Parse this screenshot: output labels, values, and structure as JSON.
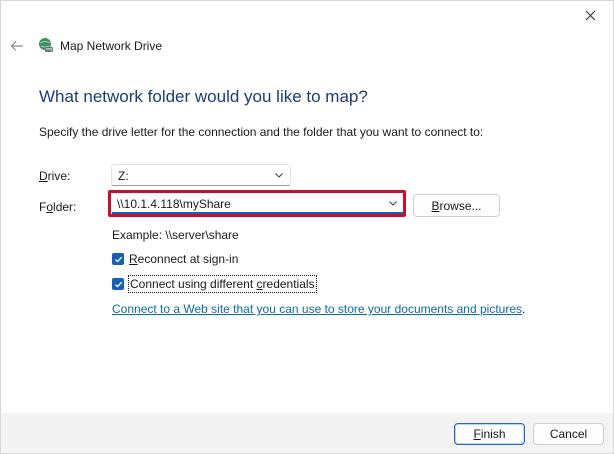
{
  "wizard": {
    "title": "Map Network Drive"
  },
  "main": {
    "heading": "What network folder would you like to map?",
    "instruction": "Specify the drive letter for the connection and the folder that you want to connect to:"
  },
  "drive": {
    "label_accel": "D",
    "label_rest": "rive:",
    "value": "Z:"
  },
  "folder": {
    "label_pre": "F",
    "label_accel": "o",
    "label_rest": "lder:",
    "value": "\\\\10.1.4.118\\myShare",
    "browse_accel": "B",
    "browse_rest": "rowse..."
  },
  "example": "Example: \\\\server\\share",
  "options": {
    "reconnect": {
      "label_accel": "R",
      "label_rest": "econnect at sign-in",
      "checked": true
    },
    "credentials": {
      "label_pre": "Connect using different ",
      "label_accel": "c",
      "label_rest": "redentials",
      "checked": true
    }
  },
  "link": {
    "text": "Connect to a Web site that you can use to store your documents and pictures",
    "suffix": "."
  },
  "footer": {
    "finish_accel": "F",
    "finish_rest": "inish",
    "cancel": "Cancel"
  },
  "icons": {
    "close": "close-icon",
    "back": "back-arrow-icon",
    "wizard": "network-drive-icon",
    "chevron": "chevron-down-icon",
    "check": "checkmark-icon"
  },
  "colors": {
    "heading": "#1e3a78",
    "accent": "#1a5fb4",
    "highlight": "#c8102e",
    "link": "#0b6aa8"
  }
}
